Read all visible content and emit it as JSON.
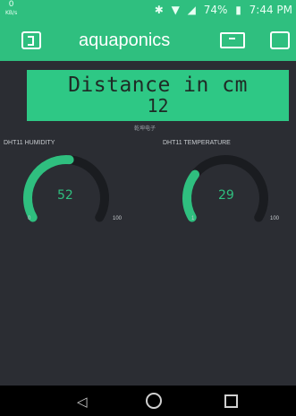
{
  "status_bar": {
    "speed_value": "0",
    "speed_unit": "KB/s",
    "battery_percent": "74%",
    "time": "7:44 PM"
  },
  "app_bar": {
    "title": "aquaponics"
  },
  "display": {
    "label": "Distance in cm",
    "value": "12",
    "sublabel": "乾坤电子"
  },
  "gauges": [
    {
      "title": "DHT11 HUMIDITY",
      "value": "52",
      "min": "0",
      "max": "100",
      "fraction": 0.52
    },
    {
      "title": "DHT11 TEMPERATURE",
      "value": "29",
      "min": "1",
      "max": "100",
      "fraction": 0.283
    }
  ],
  "colors": {
    "accent": "#2fbf7f",
    "background": "#2b2d33",
    "track": "#1a1c20"
  }
}
